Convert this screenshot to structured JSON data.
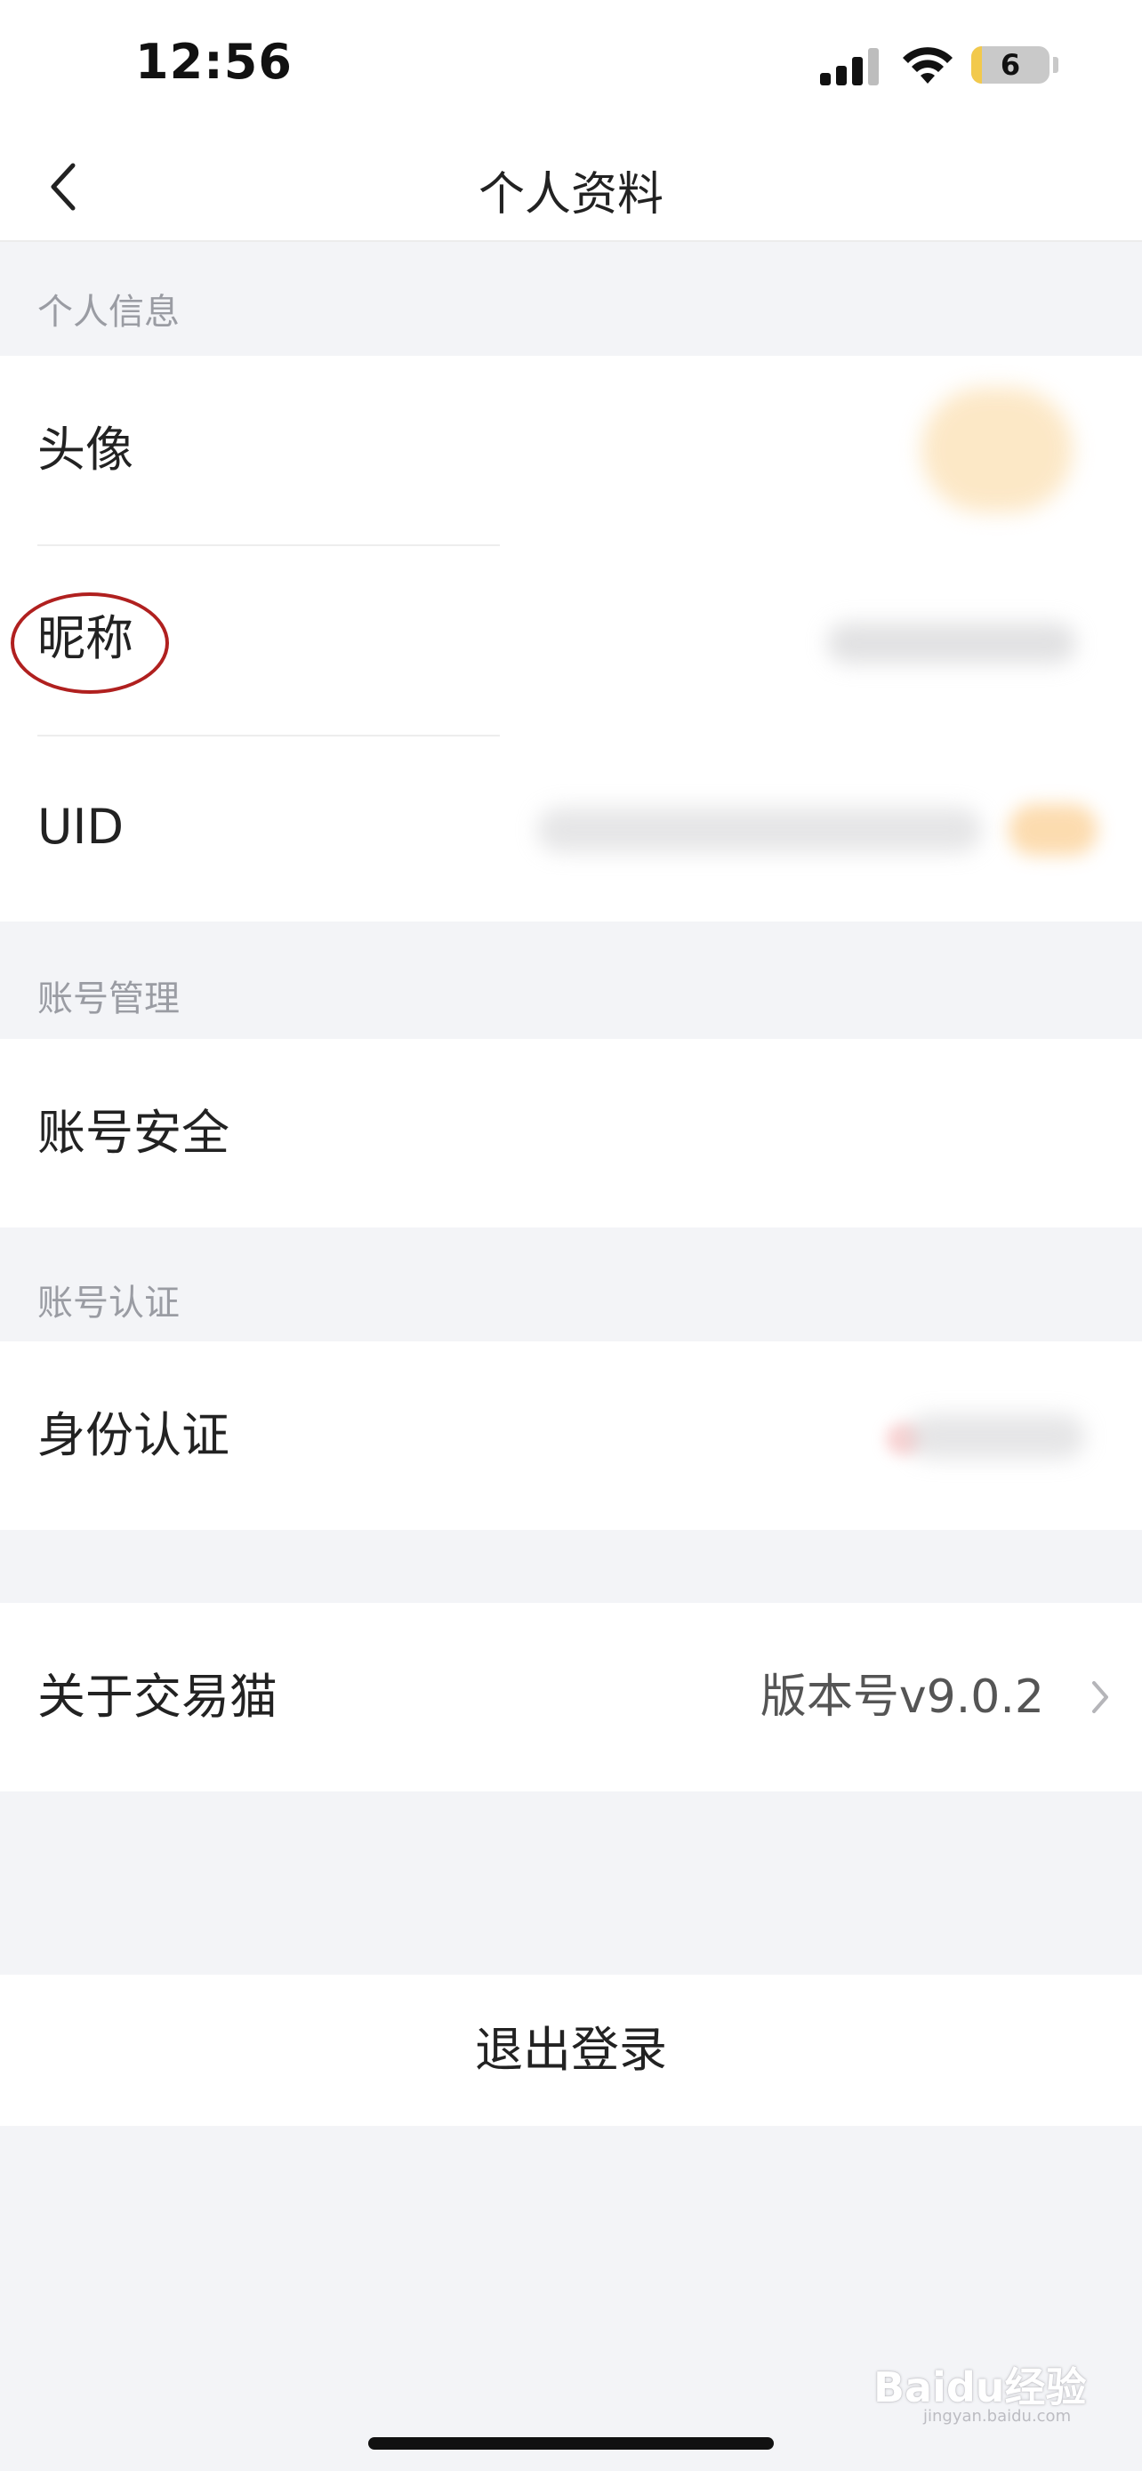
{
  "status_bar": {
    "time": "12:56",
    "battery_level": "6"
  },
  "header": {
    "title": "个人资料"
  },
  "sections": {
    "personal_info": {
      "label": "个人信息",
      "rows": [
        "头像",
        "昵称",
        "UID"
      ]
    },
    "account_management": {
      "label": "账号管理",
      "rows": [
        "账号安全"
      ]
    },
    "account_verification": {
      "label": "账号认证",
      "rows": [
        "身份认证"
      ]
    }
  },
  "about": {
    "label": "关于交易猫",
    "value": "版本号v9.0.2"
  },
  "logout": {
    "label": "退出登录"
  },
  "watermark": {
    "text": "Baidu经验",
    "sub": "jingyan.baidu.com"
  },
  "colors": {
    "background": "#f3f4f7",
    "annotation": "#b0201f",
    "section_label": "#9a9ca3"
  }
}
